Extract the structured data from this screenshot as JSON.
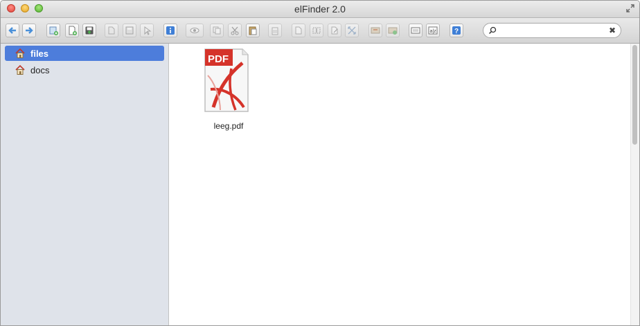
{
  "window": {
    "title": "elFinder 2.0"
  },
  "toolbar": {
    "buttons": [
      {
        "name": "back-button",
        "icon": "arrow-left-icon",
        "enabled": true
      },
      {
        "name": "forward-button",
        "icon": "arrow-right-icon",
        "enabled": true
      },
      {
        "name": "new-folder-button",
        "icon": "new-folder-icon",
        "enabled": true
      },
      {
        "name": "new-file-button",
        "icon": "new-file-icon",
        "enabled": true
      },
      {
        "name": "upload-button",
        "icon": "upload-icon",
        "enabled": true
      },
      {
        "name": "open-button",
        "icon": "open-icon",
        "enabled": false
      },
      {
        "name": "download-button",
        "icon": "download-icon",
        "enabled": false
      },
      {
        "name": "select-button",
        "icon": "cursor-icon",
        "enabled": false
      },
      {
        "name": "info-button",
        "icon": "info-icon",
        "enabled": true
      },
      {
        "name": "quicklook-button",
        "icon": "eye-icon",
        "enabled": false
      },
      {
        "name": "copy-button",
        "icon": "copy-icon",
        "enabled": false
      },
      {
        "name": "cut-button",
        "icon": "scissors-icon",
        "enabled": false
      },
      {
        "name": "paste-button",
        "icon": "paste-icon",
        "enabled": true
      },
      {
        "name": "delete-button",
        "icon": "trash-icon",
        "enabled": false
      },
      {
        "name": "duplicate-button",
        "icon": "duplicate-icon",
        "enabled": false
      },
      {
        "name": "rename-button",
        "icon": "rename-icon",
        "enabled": false
      },
      {
        "name": "edit-button",
        "icon": "edit-icon",
        "enabled": false
      },
      {
        "name": "resize-button",
        "icon": "resize-icon",
        "enabled": false
      },
      {
        "name": "archive-button",
        "icon": "archive-icon",
        "enabled": false
      },
      {
        "name": "extract-button",
        "icon": "extract-icon",
        "enabled": false
      },
      {
        "name": "view-button",
        "icon": "view-icon",
        "enabled": true
      },
      {
        "name": "sort-button",
        "icon": "sort-icon",
        "enabled": true
      },
      {
        "name": "help-button",
        "icon": "help-icon",
        "enabled": true
      }
    ]
  },
  "search": {
    "value": "",
    "placeholder": "",
    "clear_label": "✖"
  },
  "sidebar": {
    "items": [
      {
        "label": "files",
        "selected": true,
        "icon": "home-icon"
      },
      {
        "label": "docs",
        "selected": false,
        "icon": "home-icon"
      }
    ]
  },
  "files": [
    {
      "name": "leeg.pdf",
      "type_badge": "PDF",
      "icon": "pdf-file-icon"
    }
  ],
  "colors": {
    "selection": "#4d7ddb",
    "sidebar_bg": "#dfe3ea",
    "pdf_red": "#d5332a"
  }
}
